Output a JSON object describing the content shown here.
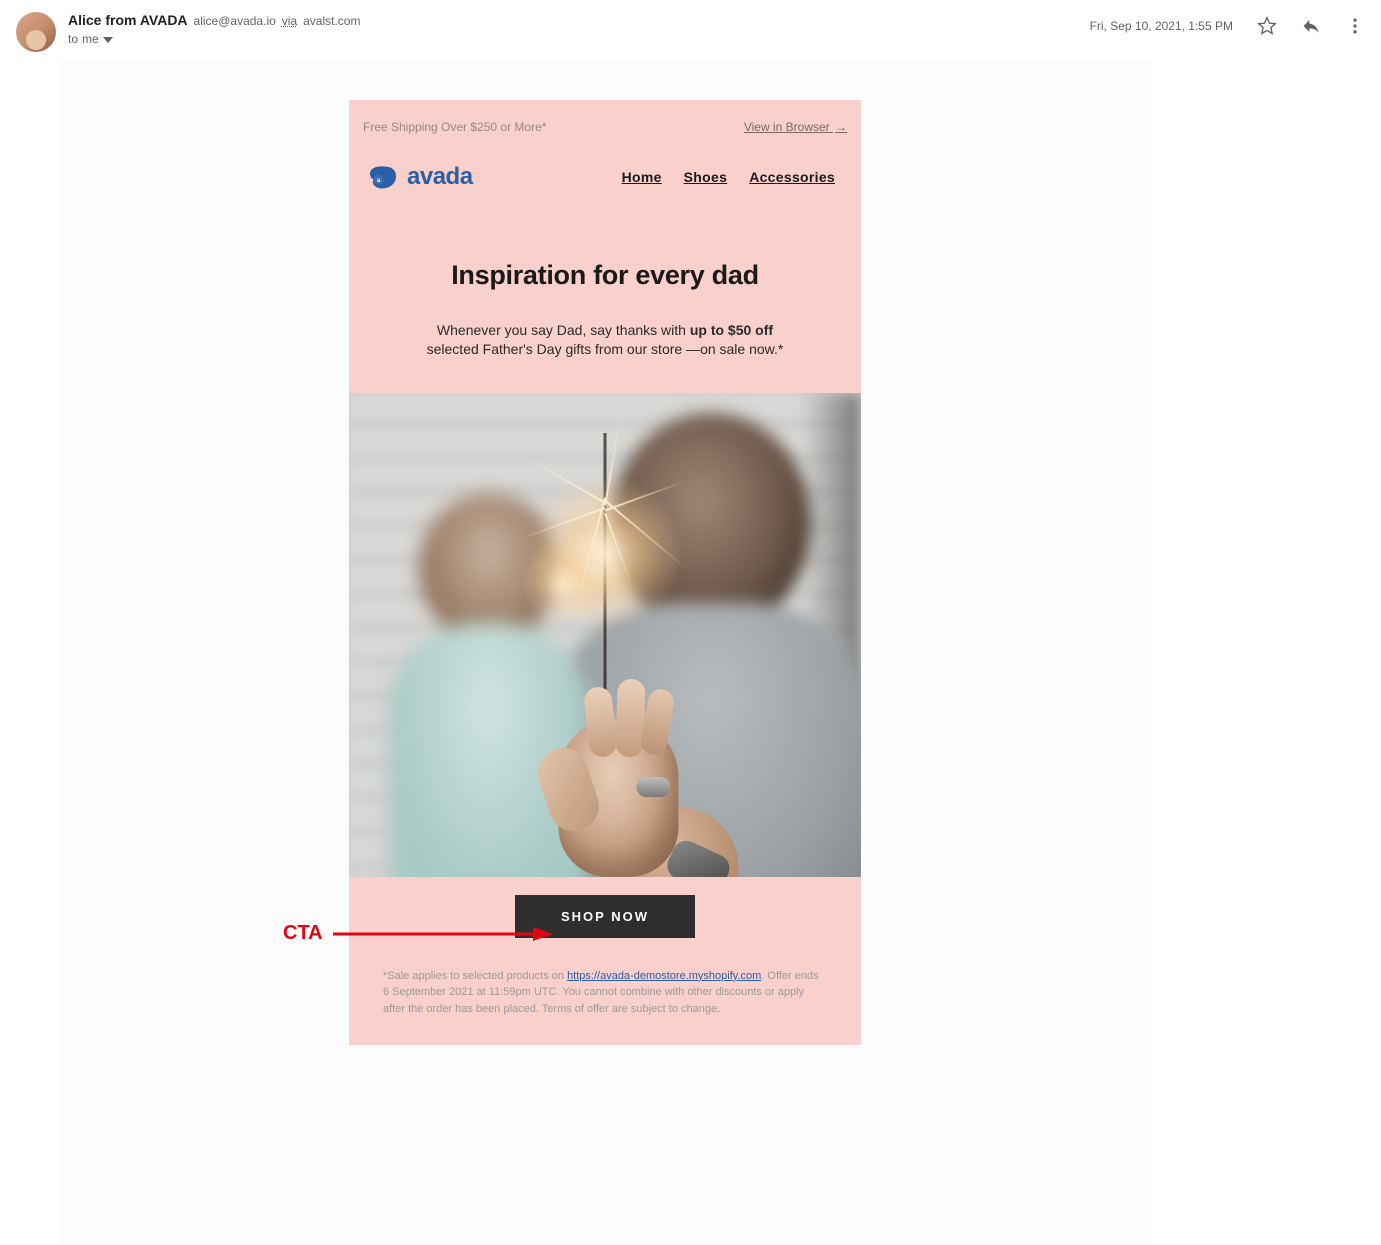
{
  "gmail": {
    "sender_name": "Alice from AVADA",
    "sender_email": "alice@avada.io",
    "via_label": "via",
    "via_host": "avalst.com",
    "to_prefix": "to",
    "to_target": "me",
    "timestamp": "Fri, Sep 10, 2021, 1:55 PM"
  },
  "email": {
    "topbar": {
      "free_shipping": "Free Shipping Over $250 or More*",
      "view_browser": "View in Browser",
      "arrow": "→"
    },
    "brand": {
      "name": "avada"
    },
    "nav": [
      "Home",
      "Shoes",
      "Accessories"
    ],
    "headline": "Inspiration for every dad",
    "subcopy": {
      "line1_pre": "Whenever you say Dad, say thanks with ",
      "line1_bold": "up to $50 off",
      "line2": "selected Father's Day gifts from our store —on sale now.*"
    },
    "cta": "SHOP NOW",
    "disclaimer": {
      "pre": "*Sale applies to selected products on ",
      "link": "https://avada-demostore.myshopify.com",
      "post": ". Offer ends 6 September 2021 at 11:59pm UTC. You cannot combine with other discounts or apply after the order has been placed. Terms of offer are subject to change."
    }
  },
  "annotation": {
    "label": "CTA"
  }
}
